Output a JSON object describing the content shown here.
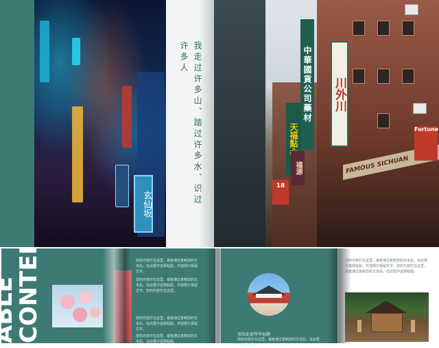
{
  "top": {
    "poem": "我走过许多山、踏过许多水、识过许多人",
    "alley_sign": "玄仙坂",
    "street_signs": {
      "a": "中華國貨公司藥材",
      "b": "川外川",
      "b_sub": "FAMOUS SICHUAN",
      "c": "天福點心",
      "d": "福源",
      "e": "FAMOUS SICHUAN",
      "f": "18",
      "g": "Fortune"
    }
  },
  "bottom": {
    "title_line1": "ABLE",
    "title_line2": "CONTENT",
    "para1": "您的内容打在这里，或者通过复制您的文本后，在此框中选择粘贴，并选择只保留文字。",
    "para2": "您的内容打在这里，或者通过复制您的文本后，在此框中选择粘贴，并选择只保留文字。您的内容打在这里。",
    "para3": "您的内容打在这里，或者通过复制您的文本后，在此框中选择粘贴，并选择只保留文字。",
    "para4": "您的内容打在这里，或者通过复制您的文本后，在此框中选择粘贴。",
    "add_title": "添加此处所有标题",
    "add_desc": "您的内容打在这里，或者通过复制您的文本后，在此框中选择粘贴。",
    "para_white": "您的内容打在这里，或者通过复制您的文本后，在此框中选择粘贴，并选择只保留文字。您的内容打在这里，或者通过复制您的文本后，在此框中选择粘贴。"
  },
  "colors": {
    "teal": "#3d7a73",
    "accent_red": "#c94f4f"
  }
}
